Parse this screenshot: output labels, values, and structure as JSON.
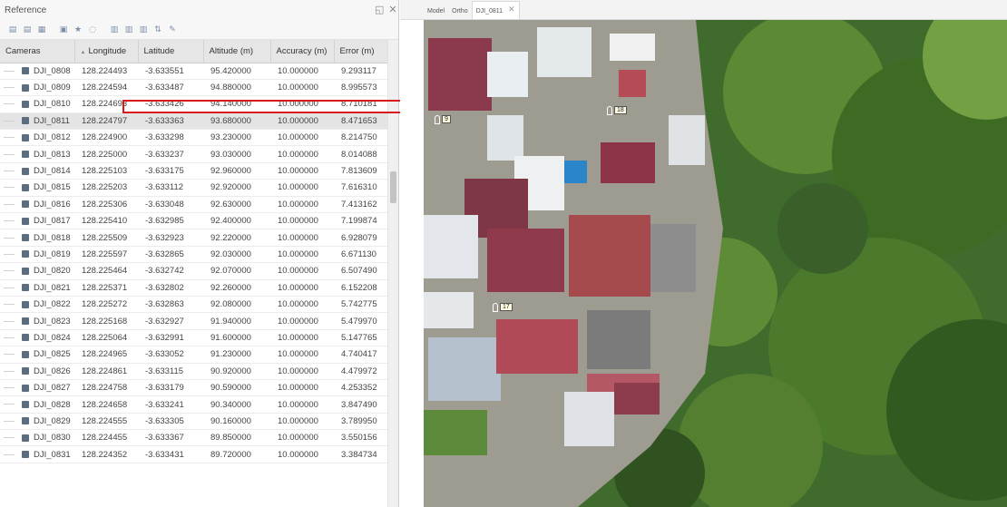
{
  "reference": {
    "title": "Reference",
    "toolbar_icons": [
      "import-icon",
      "export-icon",
      "convert-icon",
      "settings-icon",
      "star-icon",
      "optimize-icon",
      "view-errors-icon",
      "view-estimated-icon",
      "view-source-icon",
      "filter-icon",
      "clear-icon"
    ],
    "columns": [
      "Cameras",
      "Longitude",
      "Latitude",
      "Altitude (m)",
      "Accuracy (m)",
      "Error (m)"
    ],
    "selected_row": 3,
    "rows": [
      {
        "camera": "DJI_0808",
        "longitude": "128.224493",
        "latitude": "-3.633551",
        "altitude": "95.420000",
        "accuracy": "10.000000",
        "error": "9.293117"
      },
      {
        "camera": "DJI_0809",
        "longitude": "128.224594",
        "latitude": "-3.633487",
        "altitude": "94.880000",
        "accuracy": "10.000000",
        "error": "8.995573"
      },
      {
        "camera": "DJI_0810",
        "longitude": "128.224693",
        "latitude": "-3.633426",
        "altitude": "94.140000",
        "accuracy": "10.000000",
        "error": "8.710181"
      },
      {
        "camera": "DJI_0811",
        "longitude": "128.224797",
        "latitude": "-3.633363",
        "altitude": "93.680000",
        "accuracy": "10.000000",
        "error": "8.471653"
      },
      {
        "camera": "DJI_0812",
        "longitude": "128.224900",
        "latitude": "-3.633298",
        "altitude": "93.230000",
        "accuracy": "10.000000",
        "error": "8.214750"
      },
      {
        "camera": "DJI_0813",
        "longitude": "128.225000",
        "latitude": "-3.633237",
        "altitude": "93.030000",
        "accuracy": "10.000000",
        "error": "8.014088"
      },
      {
        "camera": "DJI_0814",
        "longitude": "128.225103",
        "latitude": "-3.633175",
        "altitude": "92.960000",
        "accuracy": "10.000000",
        "error": "7.813609"
      },
      {
        "camera": "DJI_0815",
        "longitude": "128.225203",
        "latitude": "-3.633112",
        "altitude": "92.920000",
        "accuracy": "10.000000",
        "error": "7.616310"
      },
      {
        "camera": "DJI_0816",
        "longitude": "128.225306",
        "latitude": "-3.633048",
        "altitude": "92.630000",
        "accuracy": "10.000000",
        "error": "7.413162"
      },
      {
        "camera": "DJI_0817",
        "longitude": "128.225410",
        "latitude": "-3.632985",
        "altitude": "92.400000",
        "accuracy": "10.000000",
        "error": "7.199874"
      },
      {
        "camera": "DJI_0818",
        "longitude": "128.225509",
        "latitude": "-3.632923",
        "altitude": "92.220000",
        "accuracy": "10.000000",
        "error": "6.928079"
      },
      {
        "camera": "DJI_0819",
        "longitude": "128.225597",
        "latitude": "-3.632865",
        "altitude": "92.030000",
        "accuracy": "10.000000",
        "error": "6.671130"
      },
      {
        "camera": "DJI_0820",
        "longitude": "128.225464",
        "latitude": "-3.632742",
        "altitude": "92.070000",
        "accuracy": "10.000000",
        "error": "6.507490"
      },
      {
        "camera": "DJI_0821",
        "longitude": "128.225371",
        "latitude": "-3.632802",
        "altitude": "92.260000",
        "accuracy": "10.000000",
        "error": "6.152208"
      },
      {
        "camera": "DJI_0822",
        "longitude": "128.225272",
        "latitude": "-3.632863",
        "altitude": "92.080000",
        "accuracy": "10.000000",
        "error": "5.742775"
      },
      {
        "camera": "DJI_0823",
        "longitude": "128.225168",
        "latitude": "-3.632927",
        "altitude": "91.940000",
        "accuracy": "10.000000",
        "error": "5.479970"
      },
      {
        "camera": "DJI_0824",
        "longitude": "128.225064",
        "latitude": "-3.632991",
        "altitude": "91.600000",
        "accuracy": "10.000000",
        "error": "5.147765"
      },
      {
        "camera": "DJI_0825",
        "longitude": "128.224965",
        "latitude": "-3.633052",
        "altitude": "91.230000",
        "accuracy": "10.000000",
        "error": "4.740417"
      },
      {
        "camera": "DJI_0826",
        "longitude": "128.224861",
        "latitude": "-3.633115",
        "altitude": "90.920000",
        "accuracy": "10.000000",
        "error": "4.479972"
      },
      {
        "camera": "DJI_0827",
        "longitude": "128.224758",
        "latitude": "-3.633179",
        "altitude": "90.590000",
        "accuracy": "10.000000",
        "error": "4.253352"
      },
      {
        "camera": "DJI_0828",
        "longitude": "128.224658",
        "latitude": "-3.633241",
        "altitude": "90.340000",
        "accuracy": "10.000000",
        "error": "3.847490"
      },
      {
        "camera": "DJI_0829",
        "longitude": "128.224555",
        "latitude": "-3.633305",
        "altitude": "90.160000",
        "accuracy": "10.000000",
        "error": "3.789950"
      },
      {
        "camera": "DJI_0830",
        "longitude": "128.224455",
        "latitude": "-3.633367",
        "altitude": "89.850000",
        "accuracy": "10.000000",
        "error": "3.550156"
      },
      {
        "camera": "DJI_0831",
        "longitude": "128.224352",
        "latitude": "-3.633431",
        "altitude": "89.720000",
        "accuracy": "10.000000",
        "error": "3.384734"
      }
    ]
  },
  "view": {
    "tabs": [
      {
        "label": "Model",
        "active": false
      },
      {
        "label": "Ortho",
        "active": false
      },
      {
        "label": "DJI_0811",
        "active": true
      }
    ],
    "markers": [
      {
        "label": "9"
      },
      {
        "label": "18"
      },
      {
        "label": "17"
      }
    ]
  },
  "colors": {
    "highlight_box": "#d7191c",
    "selected_row": "#e4e4e4",
    "header_bg": "#e6e6e6",
    "camera_icon": "#5d6d80"
  }
}
